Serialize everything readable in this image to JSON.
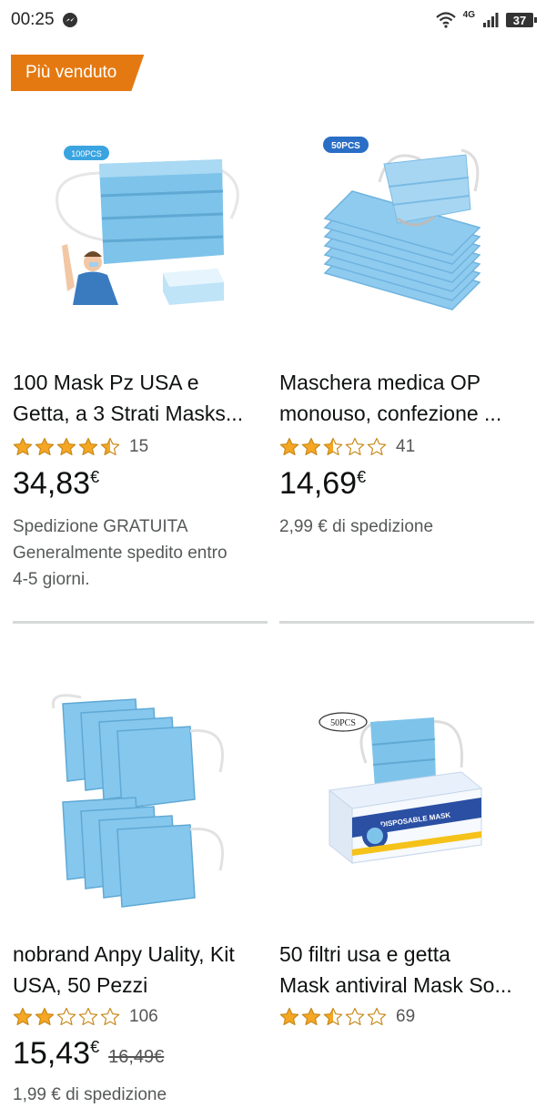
{
  "status_bar": {
    "time": "00:25",
    "network": "4G",
    "battery": "37"
  },
  "badge": "Più venduto",
  "products": [
    {
      "box_label": "100PCS",
      "title_line1": "100 Mask Pz USA e",
      "title_line2": "Getta, a 3 Strati Masks...",
      "rating": 4.5,
      "review_count": "15",
      "price": "34,83",
      "currency": "€",
      "shipping_line1": "Spedizione GRATUITA",
      "shipping_line2": "Generalmente spedito entro",
      "shipping_line3": "4-5 giorni."
    },
    {
      "box_label": "50PCS",
      "title_line1": "Maschera medica OP",
      "title_line2": "monouso, confezione ...",
      "rating": 2.5,
      "review_count": "41",
      "price": "14,69",
      "currency": "€",
      "shipping_line1": "2,99 € di spedizione"
    },
    {
      "title_line1": "nobrand Anpy Uality, Kit",
      "title_line2": "USA, 50 Pezzi",
      "rating": 2,
      "review_count": "106",
      "price": "15,43",
      "currency": "€",
      "old_price": "16,49€",
      "shipping_line1": "1,99 € di spedizione"
    },
    {
      "box_label": "50PCS",
      "box_text": "DISPOSABLE MASK",
      "title_line1": "50 filtri usa e getta",
      "title_line2": "Mask antiviral Mask So...",
      "rating": 2.5,
      "review_count": "69"
    }
  ],
  "colors": {
    "badge": "#e47911",
    "star": "#f5a623",
    "mask": "#7ec3ea",
    "divider": "#d5d9d9"
  }
}
